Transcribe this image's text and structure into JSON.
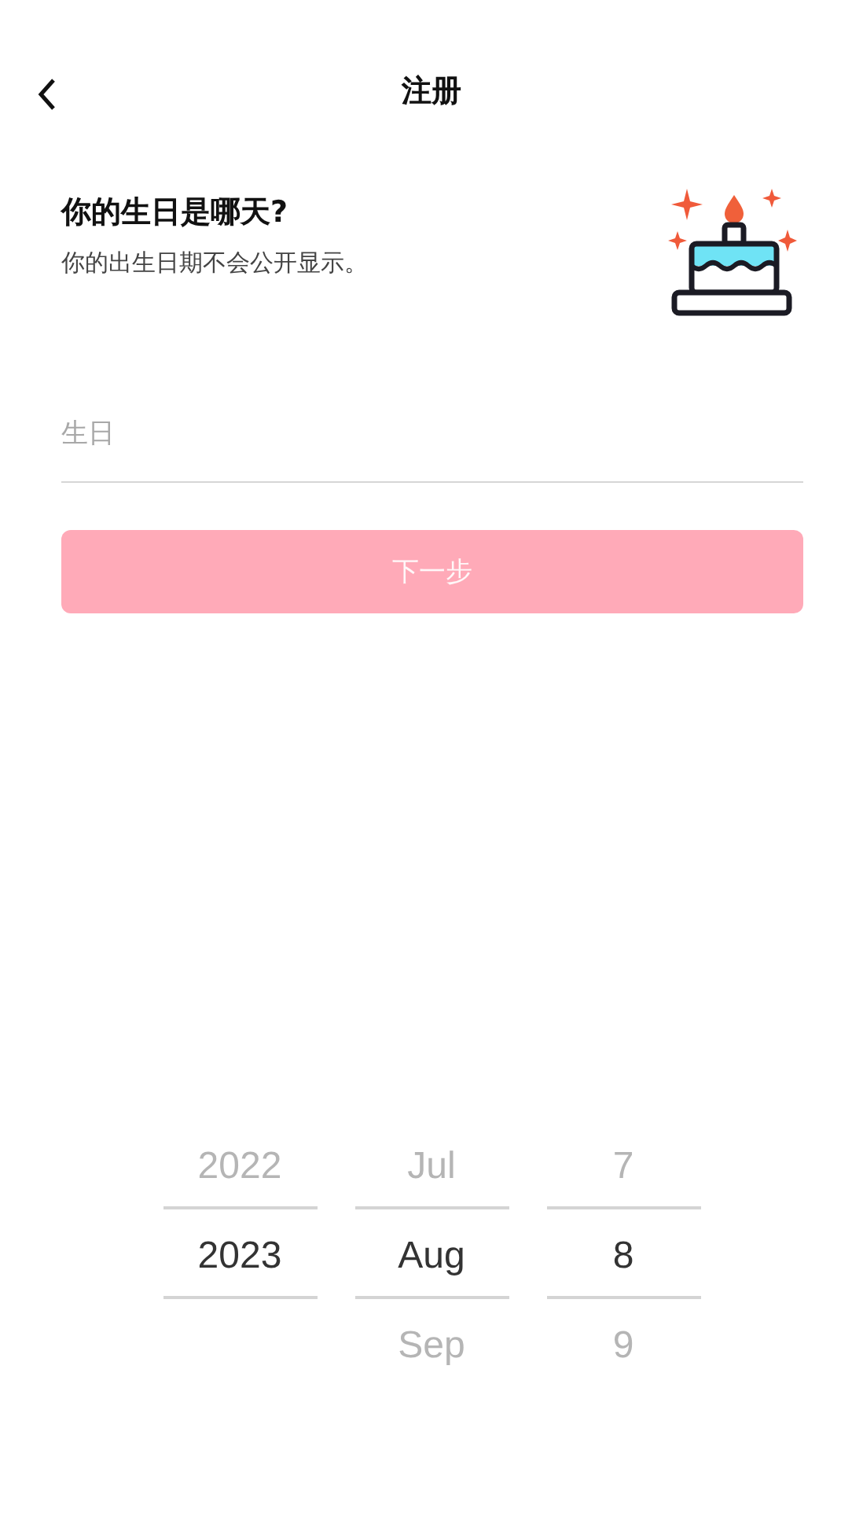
{
  "header": {
    "title": "注册"
  },
  "intro": {
    "heading": "你的生日是哪天?",
    "subtitle": "你的出生日期不会公开显示。"
  },
  "birthday_field": {
    "placeholder": "生日"
  },
  "next_button": {
    "label": "下一步",
    "disabled": true
  },
  "date_picker": {
    "columns": [
      {
        "items": [
          {
            "label": "2022",
            "selected": false
          },
          {
            "label": "2023",
            "selected": true
          }
        ]
      },
      {
        "items": [
          {
            "label": "Jul",
            "selected": false
          },
          {
            "label": "Aug",
            "selected": true
          },
          {
            "label": "Sep",
            "selected": false
          }
        ]
      },
      {
        "items": [
          {
            "label": "7",
            "selected": false
          },
          {
            "label": "8",
            "selected": true
          },
          {
            "label": "9",
            "selected": false
          }
        ]
      }
    ]
  }
}
